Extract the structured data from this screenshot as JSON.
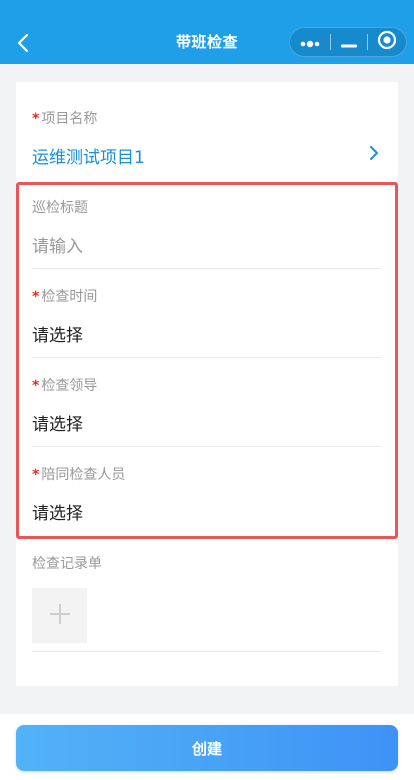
{
  "header": {
    "title": "带班检查"
  },
  "form": {
    "project": {
      "required_mark": "*",
      "label": "项目名称",
      "value": "运维测试项目1"
    },
    "inspection_title": {
      "label": "巡检标题",
      "placeholder": "请输入"
    },
    "inspection_time": {
      "required_mark": "*",
      "label": "检查时间",
      "value": "请选择"
    },
    "inspection_leader": {
      "required_mark": "*",
      "label": "检查领导",
      "value": "请选择"
    },
    "accompanying_staff": {
      "required_mark": "*",
      "label": "陪同检查人员",
      "value": "请选择"
    },
    "record_sheet": {
      "label": "检查记录单"
    }
  },
  "actions": {
    "create_label": "创建"
  },
  "colors": {
    "header": "#1e9fe8",
    "accent": "#1b8fd6",
    "required": "#e02e24",
    "highlight_border": "#e85656",
    "button_start": "#52b3f7",
    "button_end": "#3f92f6"
  },
  "icons": {
    "back": "chevron-left-icon",
    "more": "more-dots-icon",
    "minimize": "minimize-icon",
    "close": "target-close-icon",
    "project_arrow": "chevron-right-icon",
    "upload": "plus-icon"
  }
}
